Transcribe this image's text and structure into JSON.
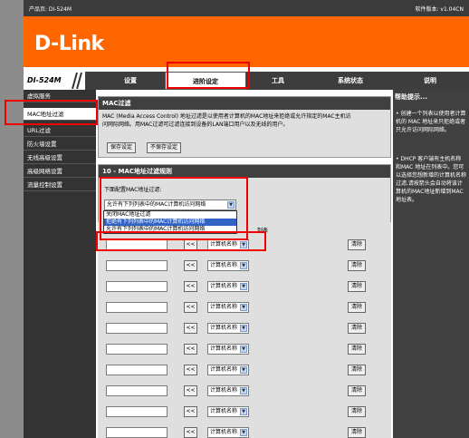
{
  "topbar": {
    "product": "产品页: DI-524M",
    "firmware": "软件版本: v1.04CN"
  },
  "logo": "D-Link",
  "model": "DI-524M",
  "nav": [
    "设置",
    "进阶设定",
    "工具",
    "系统状态",
    "说明"
  ],
  "sidebar": [
    "虚拟服务",
    "MAC地址过滤",
    "URL过滤",
    "防火墙设置",
    "无线高级设置",
    "高级网络设置",
    "流量控制设置"
  ],
  "mac_filter": {
    "title": "MAC过滤",
    "desc1": "MAC (Media Access Control) 地址过滤是以使用者计算机的MAC地址来拒绝或允许指定的MAC主机访",
    "desc2": "问网际网络。用MAC过滤可过滤连接到设备的LAN端口用户以及无线的用户。",
    "save": "保存设定",
    "nosave": "不保存设定"
  },
  "rules": {
    "title": "10 - MAC地址过滤规则",
    "config_label": "下面配置MAC地址过滤:",
    "select_value": "允许有下列列表中的MAC计算机访问网络",
    "options": [
      "关闭MAC地址过滤",
      "拒绝有下列列表中的MAC计算机访问网络",
      "允许有下列列表中的MAC计算机访问网络"
    ],
    "list_suffix": "列表",
    "arrow_label": "<<",
    "computer_select": "计算机名称",
    "clear_label": "清除"
  },
  "help": {
    "title": "帮助提示...",
    "p1": "• 创建一个列表以使用者计算机的 MAC 地址来只拒绝或者只允许访问网际网络。",
    "p2": "• DHCP 客户端有主机名称和MAC 地址在列表中。您可以选择您想新增的计算机名称过滤,请按箭头会自动将该计算机的MAC地址新增到MAC 地址表。"
  }
}
